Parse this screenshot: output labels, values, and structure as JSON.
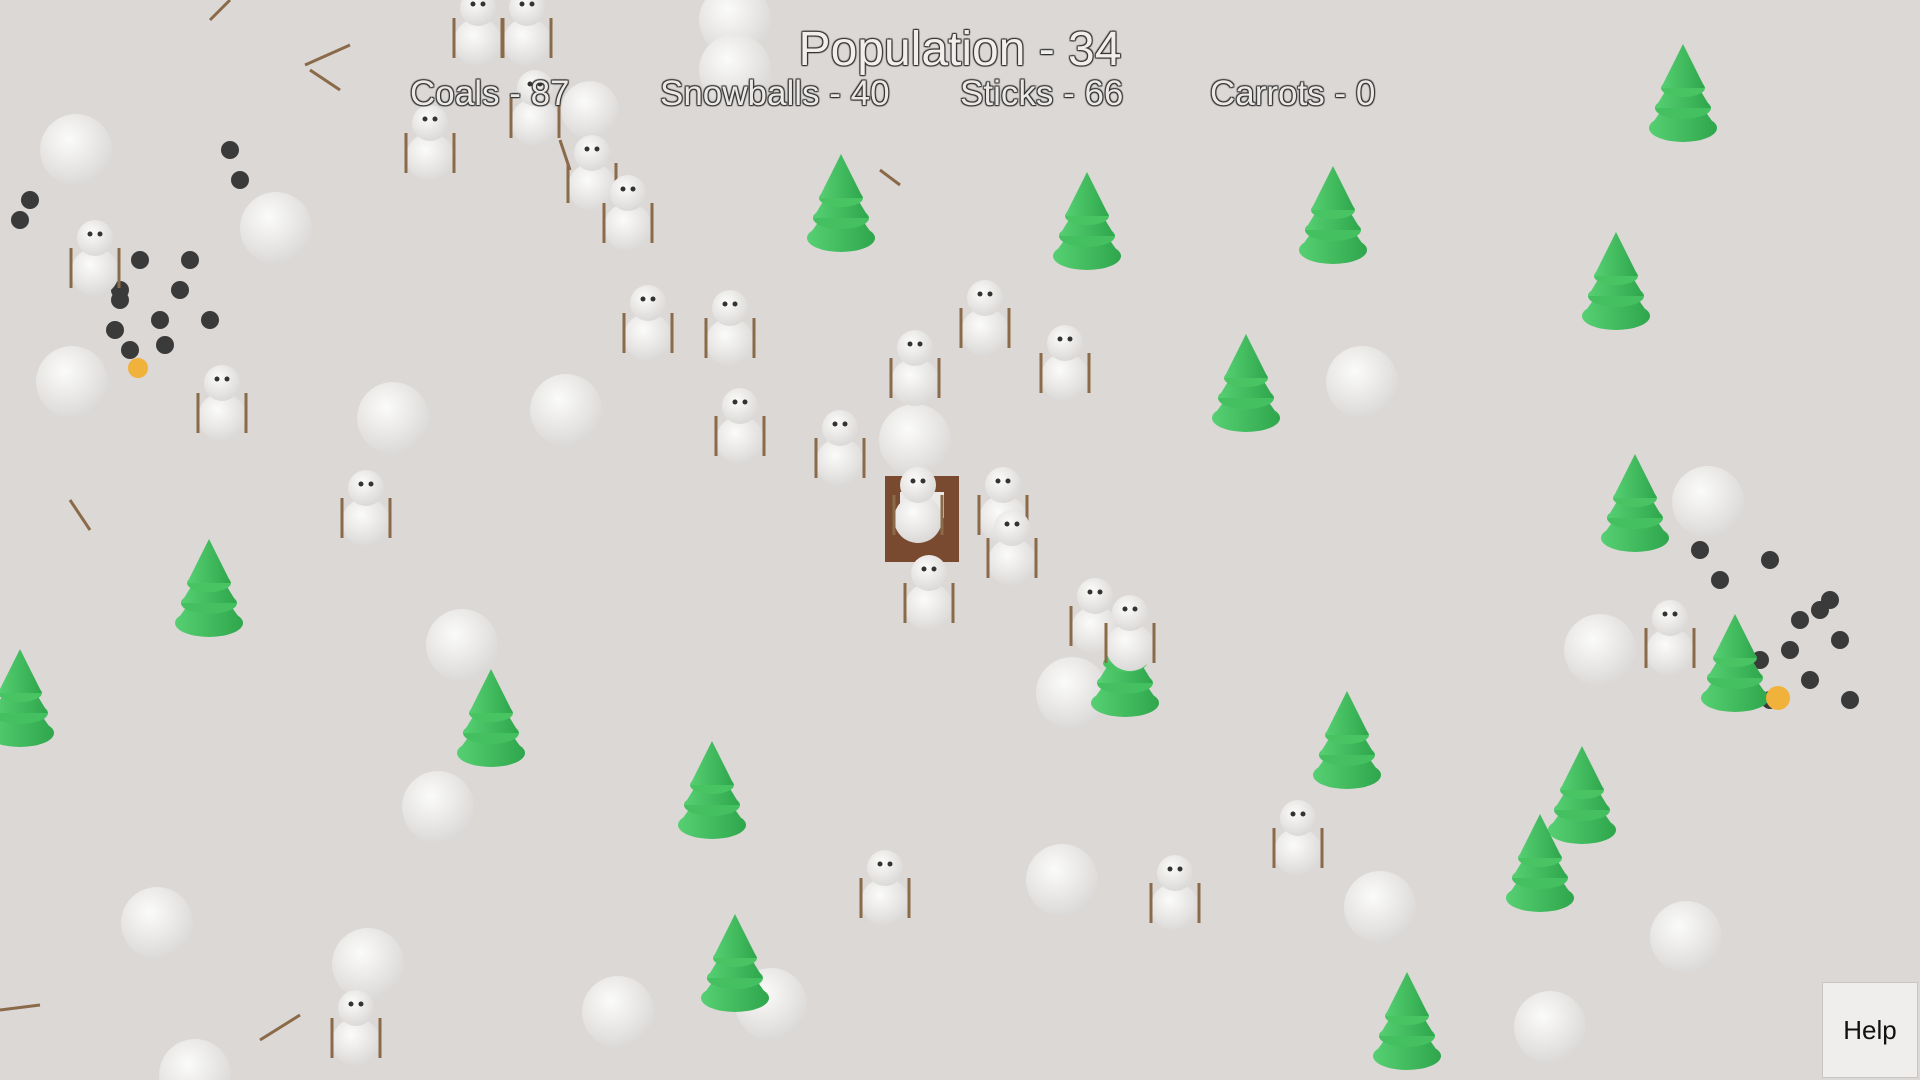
{
  "hud": {
    "population": "Population - 34",
    "resources": {
      "coals": "Coals - 87",
      "snowballs": "Snowballs - 40",
      "sticks": "Sticks - 66",
      "carrots": "Carrots - 0"
    }
  },
  "help_button": {
    "label": "Help"
  },
  "colors": {
    "ground": "#dbd8d6",
    "tree": "#3fbf5f",
    "snow": "#f2f1f0",
    "coal": "#3a3a3a",
    "stick": "#8a6a48",
    "hut": "#7a4a30"
  },
  "icons": [
    "tree-icon",
    "snowball-icon",
    "snowman-icon",
    "coal-icon",
    "stick-icon",
    "hut-icon",
    "campfire-icon"
  ]
}
